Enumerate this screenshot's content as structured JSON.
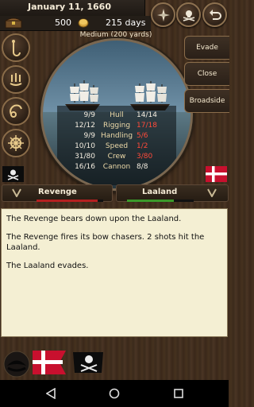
{
  "header": {
    "date": "January 11, 1660",
    "money": "500",
    "days": "215 days",
    "distance": "Medium (200 yards)"
  },
  "top_buttons": [
    "compass-icon",
    "jolly-roger-icon",
    "back-arrow-icon"
  ],
  "side_buttons": [
    "anchor-hook-icon",
    "sails-icon",
    "cannon-icon",
    "ships-wheel-icon"
  ],
  "actions": {
    "evade": "Evade",
    "close": "Close",
    "broadside": "Broadside"
  },
  "comparison": {
    "rows": [
      {
        "label": "Hull",
        "player": "9/9",
        "enemy": "14/14",
        "enemy_bad": false
      },
      {
        "label": "Rigging",
        "player": "12/12",
        "enemy": "17/18",
        "enemy_bad": true
      },
      {
        "label": "Handling",
        "player": "9/9",
        "enemy": "5/6",
        "enemy_bad": true
      },
      {
        "label": "Speed",
        "player": "10/10",
        "enemy": "1/2",
        "enemy_bad": true
      },
      {
        "label": "Crew",
        "player": "31/80",
        "enemy": "3/80",
        "enemy_bad": true
      },
      {
        "label": "Cannon",
        "player": "16/16",
        "enemy": "8/8",
        "enemy_bad": false
      }
    ]
  },
  "player_ship": {
    "name": "Revenge",
    "health": 0.92
  },
  "enemy_ship": {
    "name": "Laaland",
    "health": 0.7
  },
  "log": {
    "lines": [
      "The Revenge bears down upon the Laaland.",
      "The Revenge fires its bow chasers. 2 shots hit the Laaland.",
      "The Laaland evades."
    ]
  },
  "colors": {
    "danger": "#ff4a3a",
    "parchment": "#f4efd3",
    "wood": "#3b2a1c"
  }
}
